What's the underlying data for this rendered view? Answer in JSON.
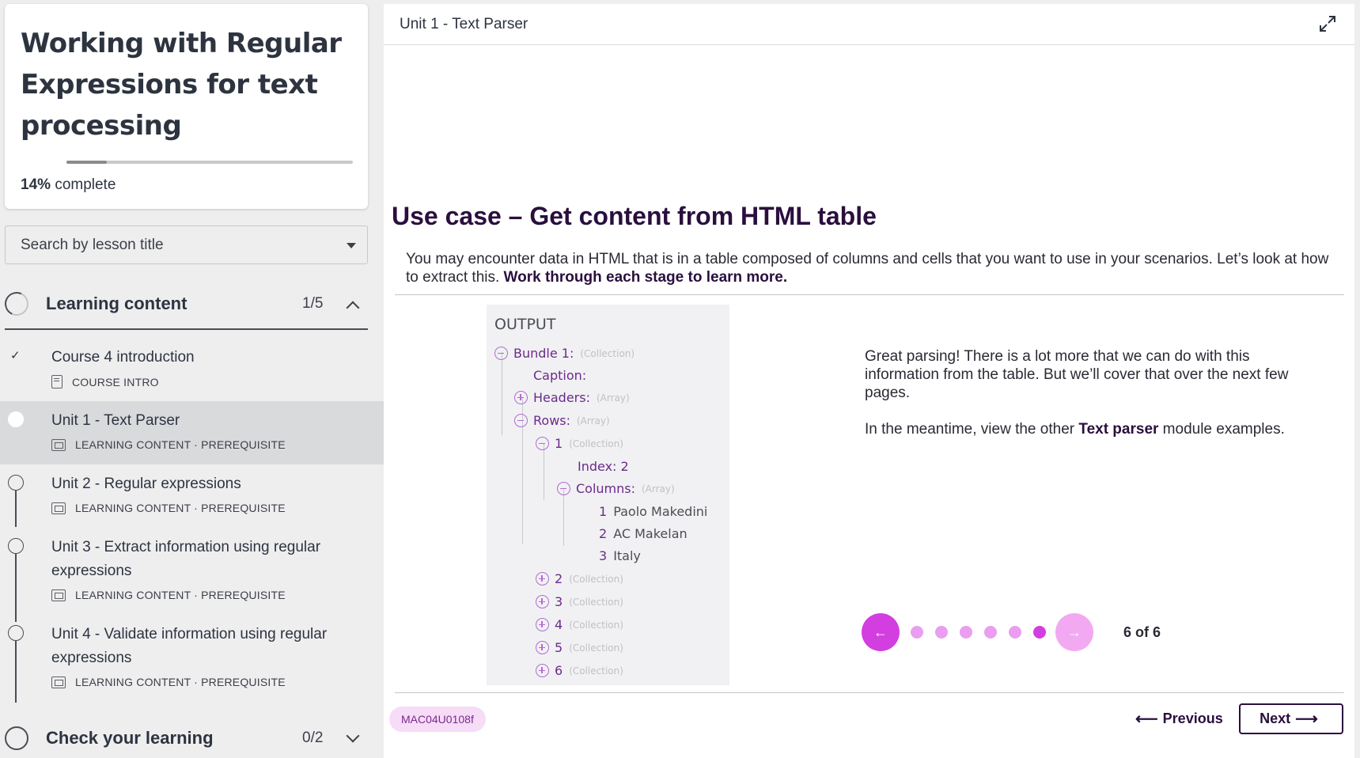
{
  "course": {
    "title": "Working with Regular Expressions for text processing",
    "progress_percent": "14%",
    "progress_suffix": "complete",
    "progress_value": 0.14
  },
  "search": {
    "placeholder": "Search by lesson title"
  },
  "sections": [
    {
      "title": "Learning content",
      "count": "1/5",
      "expanded": true
    },
    {
      "title": "Check your learning",
      "count": "0/2",
      "expanded": false
    }
  ],
  "lessons": [
    {
      "title": "Course 4 introduction",
      "meta": "COURSE INTRO",
      "status": "complete"
    },
    {
      "title": "Unit 1 - Text Parser",
      "meta": "LEARNING CONTENT · PREREQUISITE",
      "status": "active"
    },
    {
      "title": "Unit 2 - Regular expressions",
      "meta": "LEARNING CONTENT · PREREQUISITE",
      "status": "incomplete"
    },
    {
      "title": "Unit 3 - Extract information using regular expressions",
      "meta": "LEARNING CONTENT · PREREQUISITE",
      "status": "incomplete"
    },
    {
      "title": "Unit 4 - Validate information using regular expressions",
      "meta": "LEARNING CONTENT · PREREQUISITE",
      "status": "incomplete"
    }
  ],
  "main": {
    "unit_title": "Unit 1 - Text Parser",
    "heading": "Use case – Get content from HTML table",
    "intro_text": "You may encounter data in HTML that is in a table composed of columns and cells that you want to use in your scenarios. Let’s look at how to extract this. ",
    "intro_bold": "Work through each stage to learn more.",
    "output": {
      "title": "OUTPUT",
      "bundle": "Bundle 1:",
      "collection_tag": "(Collection)",
      "array_tag": "(Array)",
      "caption": "Caption:",
      "headers": "Headers:",
      "rows": "Rows:",
      "row_1": "1",
      "index": "Index: 2",
      "columns": "Columns:",
      "col_values": [
        {
          "num": "1",
          "value": "Paolo Makedini"
        },
        {
          "num": "2",
          "value": "AC Makelan"
        },
        {
          "num": "3",
          "value": "Italy"
        }
      ],
      "more_rows": [
        "2",
        "3",
        "4",
        "5",
        "6"
      ]
    },
    "side_p1": "Great parsing! There is a lot more that we can do with this information from the table. But we’ll cover that over the next few pages.",
    "side_p2_a": "In the meantime, view the other ",
    "side_p2_bold": "Text parser",
    "side_p2_b": " module examples.",
    "pager": {
      "current": 6,
      "total": 6,
      "label": "6 of 6",
      "prev_icon": "arrow-left-icon",
      "next_icon": "arrow-right-icon"
    },
    "code_badge": "MAC04U0108f",
    "prev_label": "Previous",
    "next_label": "Next"
  },
  "colors": {
    "accent": "#d33ee0",
    "accent_light": "#e99ef0",
    "heading": "#2a0f3e",
    "badge_bg": "#f6dcf6"
  }
}
